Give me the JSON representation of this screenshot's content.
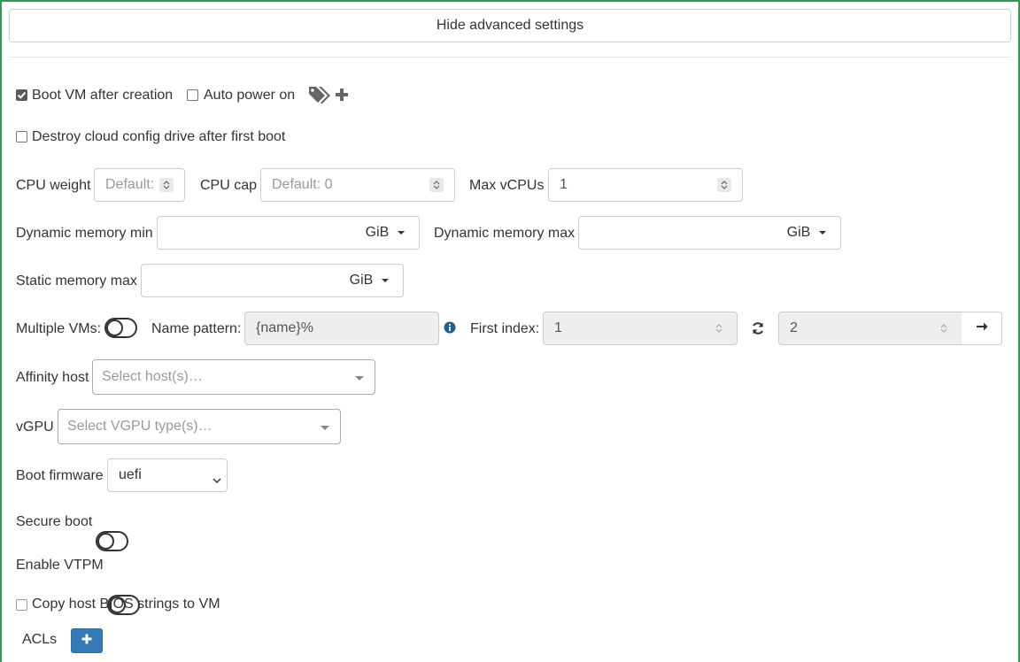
{
  "advanced_toggle": {
    "label": "Hide advanced settings"
  },
  "boot_vm": {
    "label": "Boot VM after creation",
    "checked": true
  },
  "auto_power": {
    "label": "Auto power on",
    "checked": false
  },
  "tags": {
    "icon": "tags-icon",
    "add_icon": "plus-icon"
  },
  "destroy_cloud_config": {
    "label": "Destroy cloud config drive after first boot",
    "checked": false
  },
  "cpu_weight": {
    "label": "CPU weight",
    "placeholder": "Default:"
  },
  "cpu_cap": {
    "label": "CPU cap",
    "placeholder": "Default: 0"
  },
  "max_vcpus": {
    "label": "Max vCPUs",
    "value": "1"
  },
  "dyn_mem_min": {
    "label": "Dynamic memory min",
    "value": "",
    "unit": "GiB"
  },
  "dyn_mem_max": {
    "label": "Dynamic memory max",
    "value": "",
    "unit": "GiB"
  },
  "static_mem_max": {
    "label": "Static memory max",
    "value": "",
    "unit": "GiB"
  },
  "multiple_vms": {
    "label": "Multiple VMs:",
    "enabled": false,
    "name_pattern_label": "Name pattern:",
    "name_pattern_value": "{name}%",
    "first_index_label": "First index:",
    "first_index_value": "1",
    "count_value": "2"
  },
  "affinity_host": {
    "label": "Affinity host",
    "placeholder": "Select host(s)…"
  },
  "vgpu": {
    "label": "vGPU",
    "placeholder": "Select VGPU type(s)…"
  },
  "boot_firmware": {
    "label": "Boot firmware",
    "value": "uefi"
  },
  "secure_boot": {
    "label": "Secure boot",
    "enabled": false
  },
  "vtpm": {
    "label": "Enable VTPM",
    "enabled": false
  },
  "copy_bios": {
    "label": "Copy host BIOS strings to VM",
    "checked": false
  },
  "acls": {
    "label": "ACLs"
  },
  "colors": {
    "frame": "#2e9a4f",
    "primary": "#337ab7",
    "border": "#cccccc",
    "disabled_bg": "#eeeeee"
  }
}
